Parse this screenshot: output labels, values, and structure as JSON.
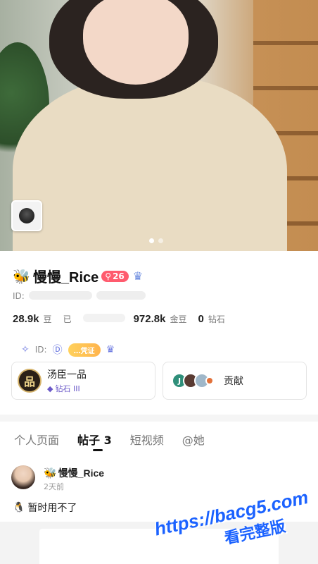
{
  "hero": {
    "dots_count": 2,
    "active_dot": 0
  },
  "profile": {
    "username": "慢慢_Rice",
    "level_badge": "26",
    "id_label": "ID:",
    "stats": [
      {
        "value": "28.9k",
        "label": "豆"
      },
      {
        "value": "",
        "label": "已"
      },
      {
        "value": "972.8k",
        "label": "金豆"
      },
      {
        "value": "0",
        "label": "钻石"
      }
    ],
    "tag_id_label": "ID:",
    "tag_pill": "…凭证"
  },
  "cards": {
    "rank_title": "汤臣一品",
    "rank_sub": "钻石 III",
    "contrib_label": "贡献",
    "contrib_first_initial": "J"
  },
  "tabs": [
    {
      "label": "个人页面"
    },
    {
      "label": "帖子 3"
    },
    {
      "label": "短视频"
    },
    {
      "label": "@她"
    }
  ],
  "post": {
    "author": "慢慢_Rice",
    "time": "2天前",
    "text": "暂时用不了"
  },
  "watermark": {
    "line1": "https://bacg5.com",
    "line2": "看完整版"
  },
  "colors": {
    "level_badge": "#ff5b6e",
    "watermark": "#1b62ff"
  }
}
